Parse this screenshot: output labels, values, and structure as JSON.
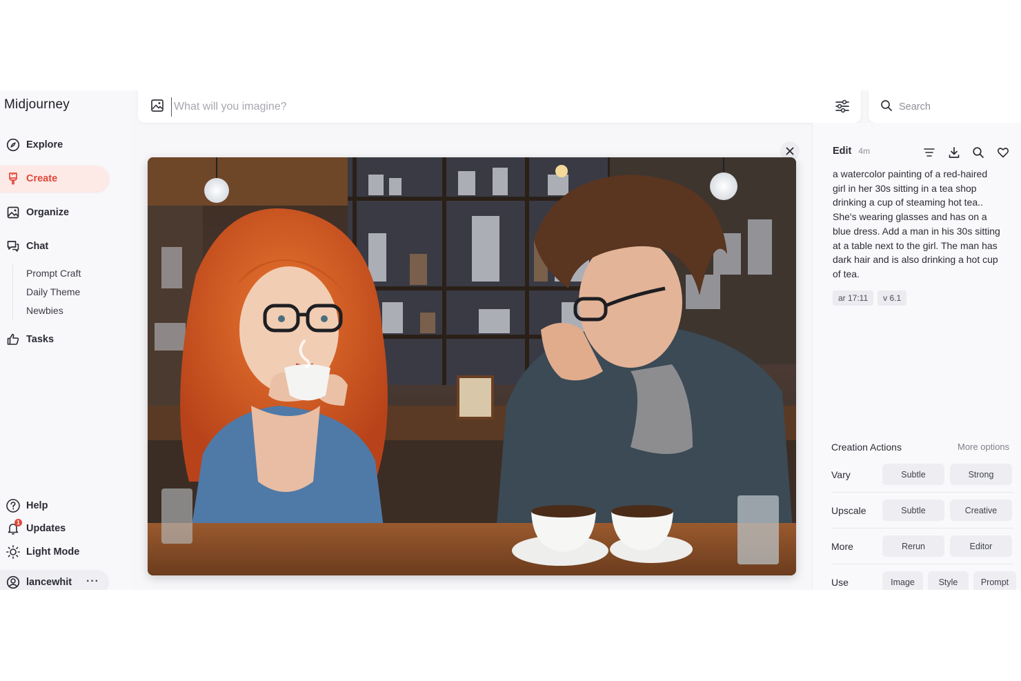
{
  "app": {
    "title": "Midjourney"
  },
  "sidebar": {
    "items": [
      {
        "label": "Explore",
        "icon": "compass-icon"
      },
      {
        "label": "Create",
        "icon": "brush-icon",
        "active": true
      },
      {
        "label": "Organize",
        "icon": "image-icon"
      },
      {
        "label": "Chat",
        "icon": "chat-icon"
      },
      {
        "label": "Tasks",
        "icon": "thumbs-up-icon"
      }
    ],
    "chat_rooms": [
      "Prompt Craft",
      "Daily Theme",
      "Newbies"
    ],
    "bottom": [
      {
        "label": "Help",
        "icon": "help-icon"
      },
      {
        "label": "Updates",
        "icon": "bell-icon",
        "badge": "1"
      },
      {
        "label": "Light Mode",
        "icon": "sun-icon"
      }
    ],
    "user": {
      "name": "lancewhit",
      "menu": "···"
    }
  },
  "prompt_bar": {
    "placeholder": "What will you imagine?"
  },
  "search": {
    "placeholder": "Search"
  },
  "details": {
    "edit_label": "Edit",
    "time": "4m",
    "prompt": "a watercolor painting of a red-haired girl in her 30s sitting in a tea shop drinking a cup of steaming hot tea.. She's wearing glasses and has on a blue dress. Add a man in his 30s sitting at a table next to the girl. The man has dark hair and is also drinking a hot cup of tea.",
    "params": [
      "ar 17:11",
      "v 6.1"
    ],
    "creation_actions": {
      "title": "Creation Actions",
      "more": "More options",
      "rows": [
        {
          "label": "Vary",
          "buttons": [
            "Subtle",
            "Strong"
          ]
        },
        {
          "label": "Upscale",
          "buttons": [
            "Subtle",
            "Creative"
          ]
        },
        {
          "label": "More",
          "buttons": [
            "Rerun",
            "Editor"
          ]
        },
        {
          "label": "Use",
          "buttons": [
            "Image",
            "Style",
            "Prompt"
          ]
        }
      ]
    }
  },
  "colors": {
    "accent": "#e2483a",
    "active_bg": "#fde9e6",
    "panel_bg": "#f9f9fb",
    "button_bg": "#eeeef2"
  }
}
